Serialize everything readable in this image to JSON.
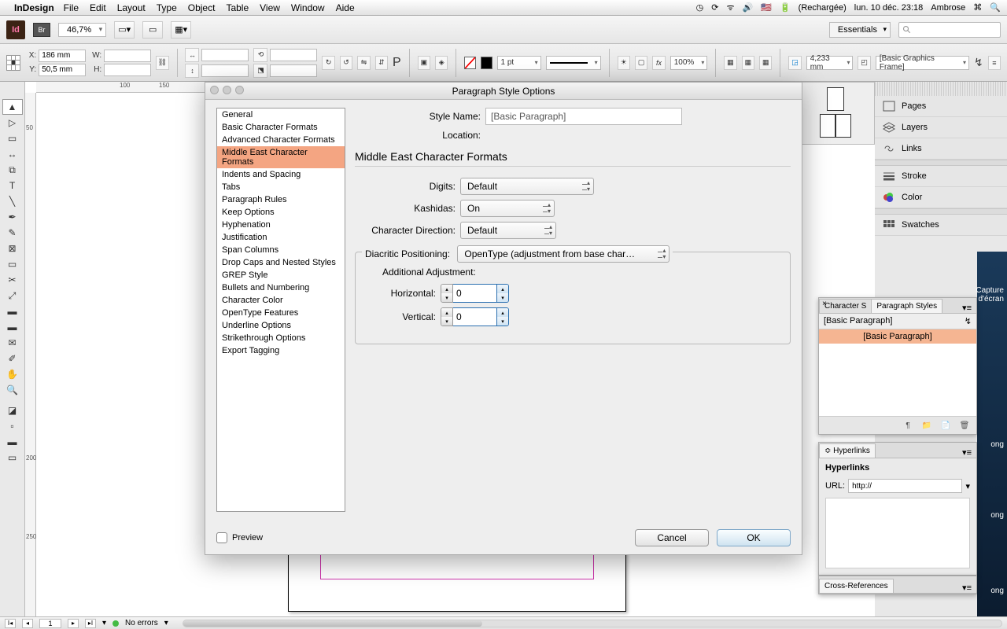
{
  "menubar": {
    "app": "InDesign",
    "items": [
      "File",
      "Edit",
      "Layout",
      "Type",
      "Object",
      "Table",
      "View",
      "Window",
      "Aide"
    ],
    "battery": "(Rechargée)",
    "clock": "lun. 10 déc.  23:18",
    "user": "Ambrose"
  },
  "top": {
    "zoom": "46,7%",
    "workspace": "Essentials"
  },
  "ctrl2": {
    "x": "186 mm",
    "y": "50,5 mm",
    "w": "",
    "h": "",
    "stroke_w": "1 pt",
    "opacity": "100%",
    "gap": "4,233 mm",
    "style_preset": "[Basic Graphics Frame]"
  },
  "ruler": {
    "m50": "50",
    "m100": "100",
    "m150": "150",
    "m200": "200",
    "m250": "250"
  },
  "dock": {
    "pages": "Pages",
    "layers": "Layers",
    "links": "Links",
    "stroke": "Stroke",
    "color": "Color",
    "swatches": "Swatches"
  },
  "dialog": {
    "title": "Paragraph Style Options",
    "categories": [
      "General",
      "Basic Character Formats",
      "Advanced Character Formats",
      "Middle East Character Formats",
      "Indents and Spacing",
      "Tabs",
      "Paragraph Rules",
      "Keep Options",
      "Hyphenation",
      "Justification",
      "Span Columns",
      "Drop Caps and Nested Styles",
      "GREP Style",
      "Bullets and Numbering",
      "Character Color",
      "OpenType Features",
      "Underline Options",
      "Strikethrough Options",
      "Export Tagging"
    ],
    "selected_index": 3,
    "style_name_label": "Style Name:",
    "style_name": "[Basic Paragraph]",
    "location_label": "Location:",
    "section": "Middle East Character Formats",
    "digits_label": "Digits:",
    "digits": "Default",
    "kashidas_label": "Kashidas:",
    "kashidas": "On",
    "chardir_label": "Character Direction:",
    "chardir": "Default",
    "diacritic_label": "Diacritic Positioning:",
    "diacritic": "OpenType (adjustment from base char…",
    "additional": "Additional Adjustment:",
    "horizontal_label": "Horizontal:",
    "horizontal": "0",
    "vertical_label": "Vertical:",
    "vertical": "0",
    "preview": "Preview",
    "cancel": "Cancel",
    "ok": "OK"
  },
  "styles_panel": {
    "tab1": "Character S",
    "tab2": "Paragraph Styles",
    "row1": "[Basic Paragraph]",
    "row2": "[Basic Paragraph]"
  },
  "hyper_panel": {
    "tab": "Hyperlinks",
    "header": "Hyperlinks",
    "url_label": "URL:",
    "url_value": "http://"
  },
  "cross_panel": {
    "tab": "Cross-References"
  },
  "desktop": {
    "caption": "Capture d'écran",
    "ong": "ong"
  },
  "bottom": {
    "page": "1",
    "errors": "No errors"
  }
}
